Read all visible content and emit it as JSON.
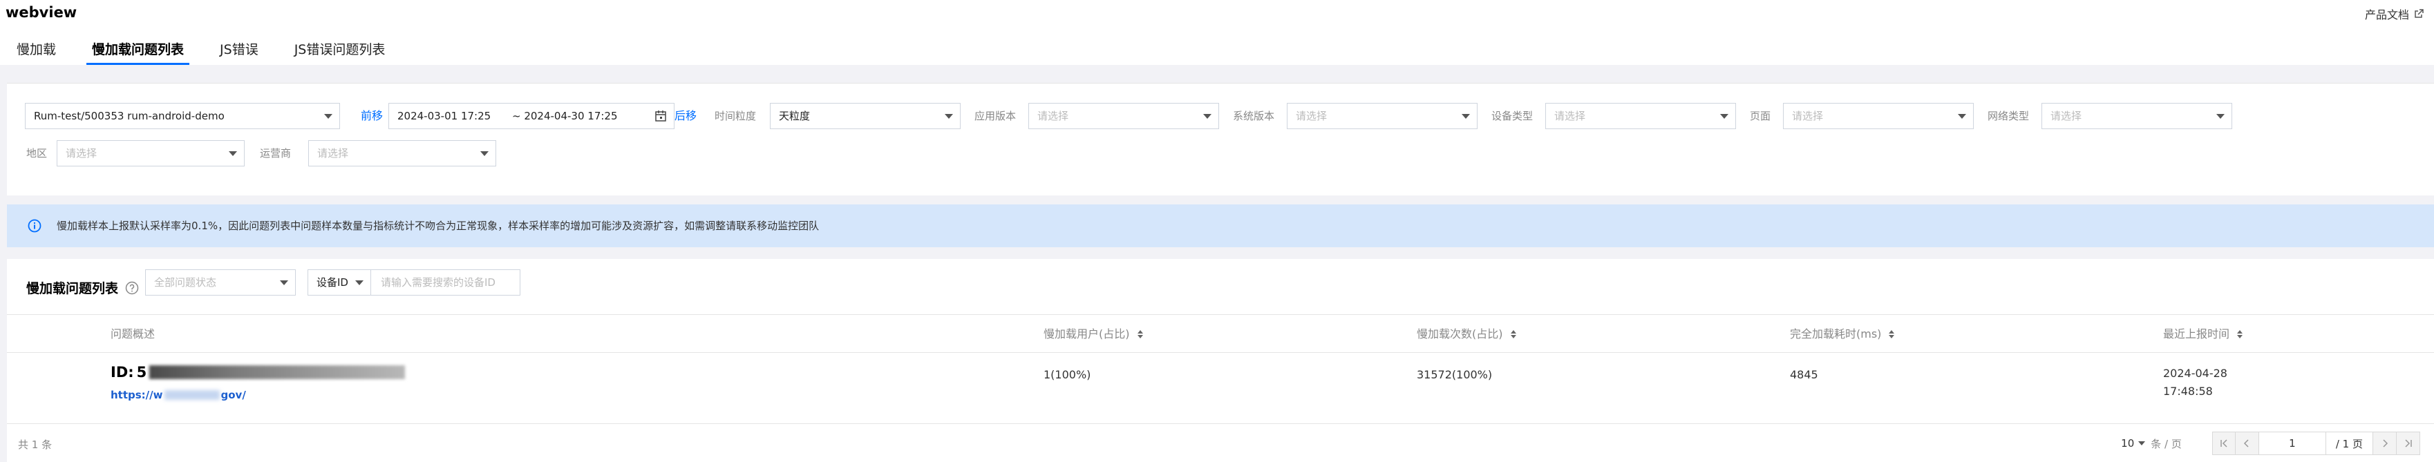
{
  "app": {
    "title": "webview",
    "doc_link": "产品文档"
  },
  "tabs": [
    {
      "label": "慢加载",
      "active": false
    },
    {
      "label": "慢加载问题列表",
      "active": true
    },
    {
      "label": "JS错误",
      "active": false
    },
    {
      "label": "JS错误问题列表",
      "active": false
    }
  ],
  "filters": {
    "project": "Rum-test/500353 rum-android-demo",
    "prev_label": "前移",
    "next_label": "后移",
    "date_start": "2024-03-01 17:25",
    "date_end": "~ 2024-04-30 17:25",
    "granularity_label": "时间粒度",
    "granularity_value": "天粒度",
    "app_version_label": "应用版本",
    "os_version_label": "系统版本",
    "device_type_label": "设备类型",
    "page_label": "页面",
    "network_label": "网络类型",
    "region_label": "地区",
    "carrier_label": "运营商",
    "placeholder": "请选择"
  },
  "notice": {
    "text": "慢加载样本上报默认采样率为0.1%，因此问题列表中问题样本数量与指标统计不吻合为正常现象，样本采样率的增加可能涉及资源扩容，如需调整请联系移动监控团队"
  },
  "list": {
    "title": "慢加载问题列表",
    "status_placeholder": "全部问题状态",
    "device_type": "设备ID",
    "device_placeholder": "请输入需要搜索的设备ID",
    "columns": [
      "问题概述",
      "慢加载用户(占比)",
      "慢加载次数(占比)",
      "完全加载耗时(ms)",
      "最近上报时间"
    ],
    "rows": [
      {
        "id_prefix": "ID:",
        "id_visible": "5",
        "url_prefix": "https://w",
        "url_suffix": "gov/",
        "users": "1(100%)",
        "count": "31572(100%)",
        "duration": "4845",
        "date": "2024-04-28",
        "time": "17:48:58"
      }
    ],
    "total": "共 1 条",
    "page_size": "10",
    "page_size_unit": "条 / 页",
    "current_page": "1",
    "total_pages": "/ 1 页"
  }
}
